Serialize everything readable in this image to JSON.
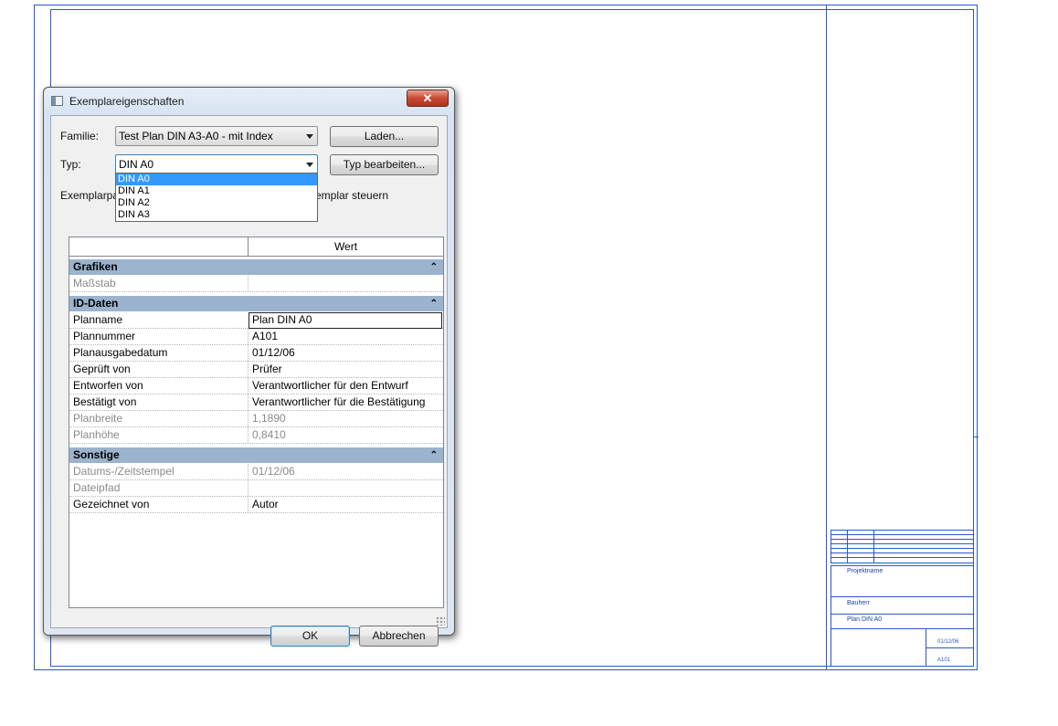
{
  "dialog": {
    "title": "Exemplareigenschaften",
    "close_glyph": "✕",
    "family_label": "Familie:",
    "family_value": "Test Plan DIN A3-A0 - mit Index",
    "load_button": "Laden...",
    "type_label": "Typ:",
    "type_value": "DIN A0",
    "edit_type_button": "Typ bearbeiten...",
    "instance_text_left": "Exemplarpar",
    "instance_text_right": "emplar steuern",
    "type_options": [
      "DIN A0",
      "DIN A1",
      "DIN A2",
      "DIN A3"
    ],
    "grid": {
      "column_value": "Wert",
      "collapse_glyph": "⌃",
      "groups": [
        {
          "title": "Grafiken",
          "rows": [
            {
              "name": "Maßstab",
              "value": "",
              "disabled": true
            }
          ]
        },
        {
          "title": "ID-Daten",
          "rows": [
            {
              "name": "Planname",
              "value": "Plan DIN A0",
              "editing": true
            },
            {
              "name": "Plannummer",
              "value": "A101"
            },
            {
              "name": "Planausgabedatum",
              "value": "01/12/06"
            },
            {
              "name": "Geprüft von",
              "value": "Prüfer"
            },
            {
              "name": "Entworfen von",
              "value": "Verantwortlicher für den Entwurf"
            },
            {
              "name": "Bestätigt von",
              "value": "Verantwortlicher für die Bestätigung"
            },
            {
              "name": "Planbreite",
              "value": "1,1890",
              "disabled": true
            },
            {
              "name": "Planhöhe",
              "value": "0,8410",
              "disabled": true
            }
          ]
        },
        {
          "title": "Sonstige",
          "rows": [
            {
              "name": "Datums-/Zeitstempel",
              "value": "01/12/06",
              "disabled": true
            },
            {
              "name": "Dateipfad",
              "value": "",
              "disabled": true
            },
            {
              "name": "Gezeichnet von",
              "value": "Autor"
            }
          ]
        }
      ]
    },
    "ok_button": "OK",
    "cancel_button": "Abbrechen"
  },
  "title_block": {
    "project_name": "Projektname",
    "client": "Bauherr",
    "sheet_title": "Plan DIN A0",
    "date": "01/12/06",
    "sheet_number": "A101"
  },
  "colors": {
    "sheet_lines": "#2b57c8",
    "group_header": "#9bb3cd",
    "selection": "#3399ff"
  }
}
